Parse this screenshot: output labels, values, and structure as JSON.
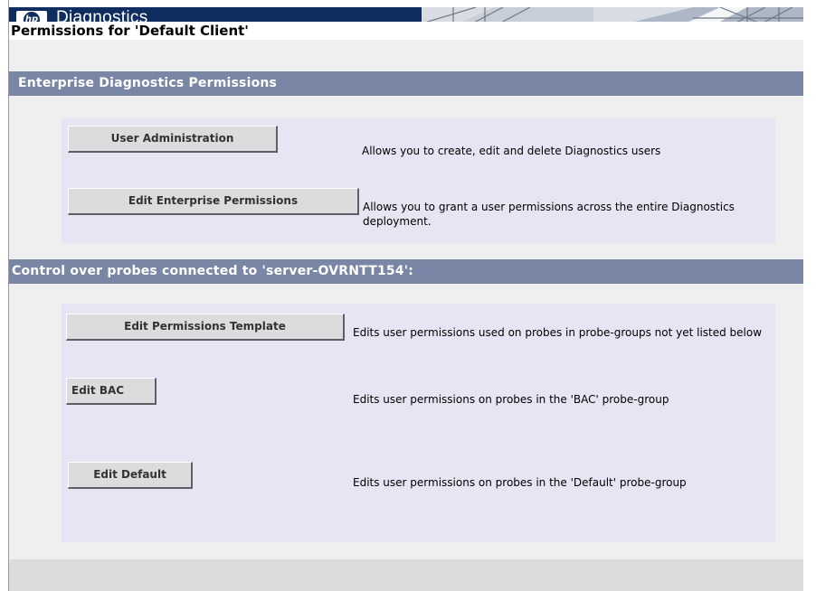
{
  "header": {
    "app_title": "Diagnostics",
    "logo_icon": "hp-logo-icon",
    "logo_text": "hp",
    "brand_color": "#0f2d5f"
  },
  "page": {
    "title": "Permissions for 'Default Client'"
  },
  "enterprise_section": {
    "heading": "Enterprise Diagnostics Permissions",
    "items": [
      {
        "button": "User Administration",
        "description": "Allows you to create, edit and delete Diagnostics users"
      },
      {
        "button": "Edit Enterprise Permissions",
        "description": "Allows you to grant a user permissions across the entire Diagnostics deployment."
      }
    ]
  },
  "probes_section": {
    "heading": "Control over probes connected to 'server-OVRNTT154':",
    "items": [
      {
        "button": "Edit Permissions Template",
        "description": "Edits user permissions used on probes in probe-groups not yet listed below"
      },
      {
        "button": "Edit BAC",
        "description": "Edits user permissions on probes in the 'BAC' probe-group"
      },
      {
        "button": "Edit Default",
        "description": "Edits user permissions on probes in the 'Default' probe-group"
      }
    ]
  },
  "colors": {
    "section_bar": "#7a86a5",
    "panel": "#e5e5f3",
    "background": "#efeff2"
  }
}
